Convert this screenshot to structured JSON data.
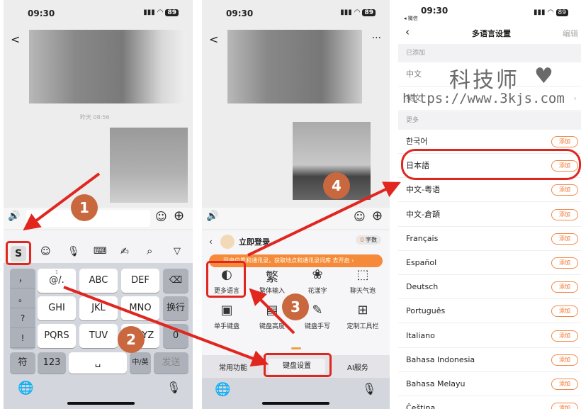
{
  "phone1": {
    "time": "09:30",
    "battery": "89",
    "back": "<",
    "timestamp": "昨天 08:56",
    "toolbar_icons": [
      "sogou-logo-icon",
      "emoji-icon",
      "microphone-icon",
      "keyboard-icon",
      "handwriting-icon",
      "search-icon",
      "collapse-icon"
    ],
    "side_keys": [
      "，",
      "。",
      "?",
      "!"
    ],
    "keys": [
      {
        "num": "1",
        "label": "@/."
      },
      {
        "num": "2",
        "label": "ABC"
      },
      {
        "num": "3",
        "label": "DEF"
      },
      {
        "num": "4",
        "label": "GHI"
      },
      {
        "num": "5",
        "label": "JKL"
      },
      {
        "num": "6",
        "label": "MNO"
      },
      {
        "num": "7",
        "label": "PQRS"
      },
      {
        "num": "8",
        "label": "TUV"
      },
      {
        "num": "9",
        "label": "WXYZ"
      }
    ],
    "backspace": "⌫",
    "newline": "换行",
    "zero": "0",
    "sym": "符",
    "num123": "123",
    "space": "␣",
    "lang": "中/英",
    "send": "发送"
  },
  "phone2": {
    "time": "09:30",
    "battery": "89",
    "back": "<",
    "more": "···",
    "login": "立即登录",
    "word_count": "0",
    "word_count_label": "字数",
    "banner": "开启位置和通讯录，获取地点和通讯录词库",
    "banner_action": "去开启 ›",
    "features": [
      {
        "icon": "globe-leaf",
        "label": "更多语言"
      },
      {
        "icon": "繁",
        "label": "繁体输入"
      },
      {
        "icon": "flower",
        "label": "花漾字"
      },
      {
        "icon": "bubble",
        "label": "聊天气泡"
      },
      {
        "icon": "one-hand",
        "label": "单手键盘"
      },
      {
        "icon": "height",
        "label": "键盘高度"
      },
      {
        "icon": "handwrite",
        "label": "键盘手写"
      },
      {
        "icon": "plus-box",
        "label": "定制工具栏"
      }
    ],
    "tabs": [
      "常用功能",
      "键盘设置",
      "AI服务"
    ]
  },
  "phone3": {
    "time": "09:30",
    "back_app": "◂ 微信",
    "battery": "89",
    "title": "多语言设置",
    "edit": "编辑",
    "added_header": "已添加",
    "added": [
      "中文",
      "英文"
    ],
    "more_header": "更多",
    "add_label": "添加",
    "languages": [
      "한국어",
      "日本語",
      "中文-粤语",
      "中文-倉頡",
      "Français",
      "Español",
      "Deutsch",
      "Português",
      "Italiano",
      "Bahasa Indonesia",
      "Bahasa Melayu",
      "Čeština"
    ]
  },
  "watermark": {
    "title": "科技师",
    "url": "https://www.3kjs.com"
  },
  "steps": [
    "1",
    "2",
    "3",
    "4"
  ],
  "colors": {
    "annotation_red": "#e0261f",
    "step_badge": "#c9673f",
    "accent_orange": "#f0702a"
  }
}
